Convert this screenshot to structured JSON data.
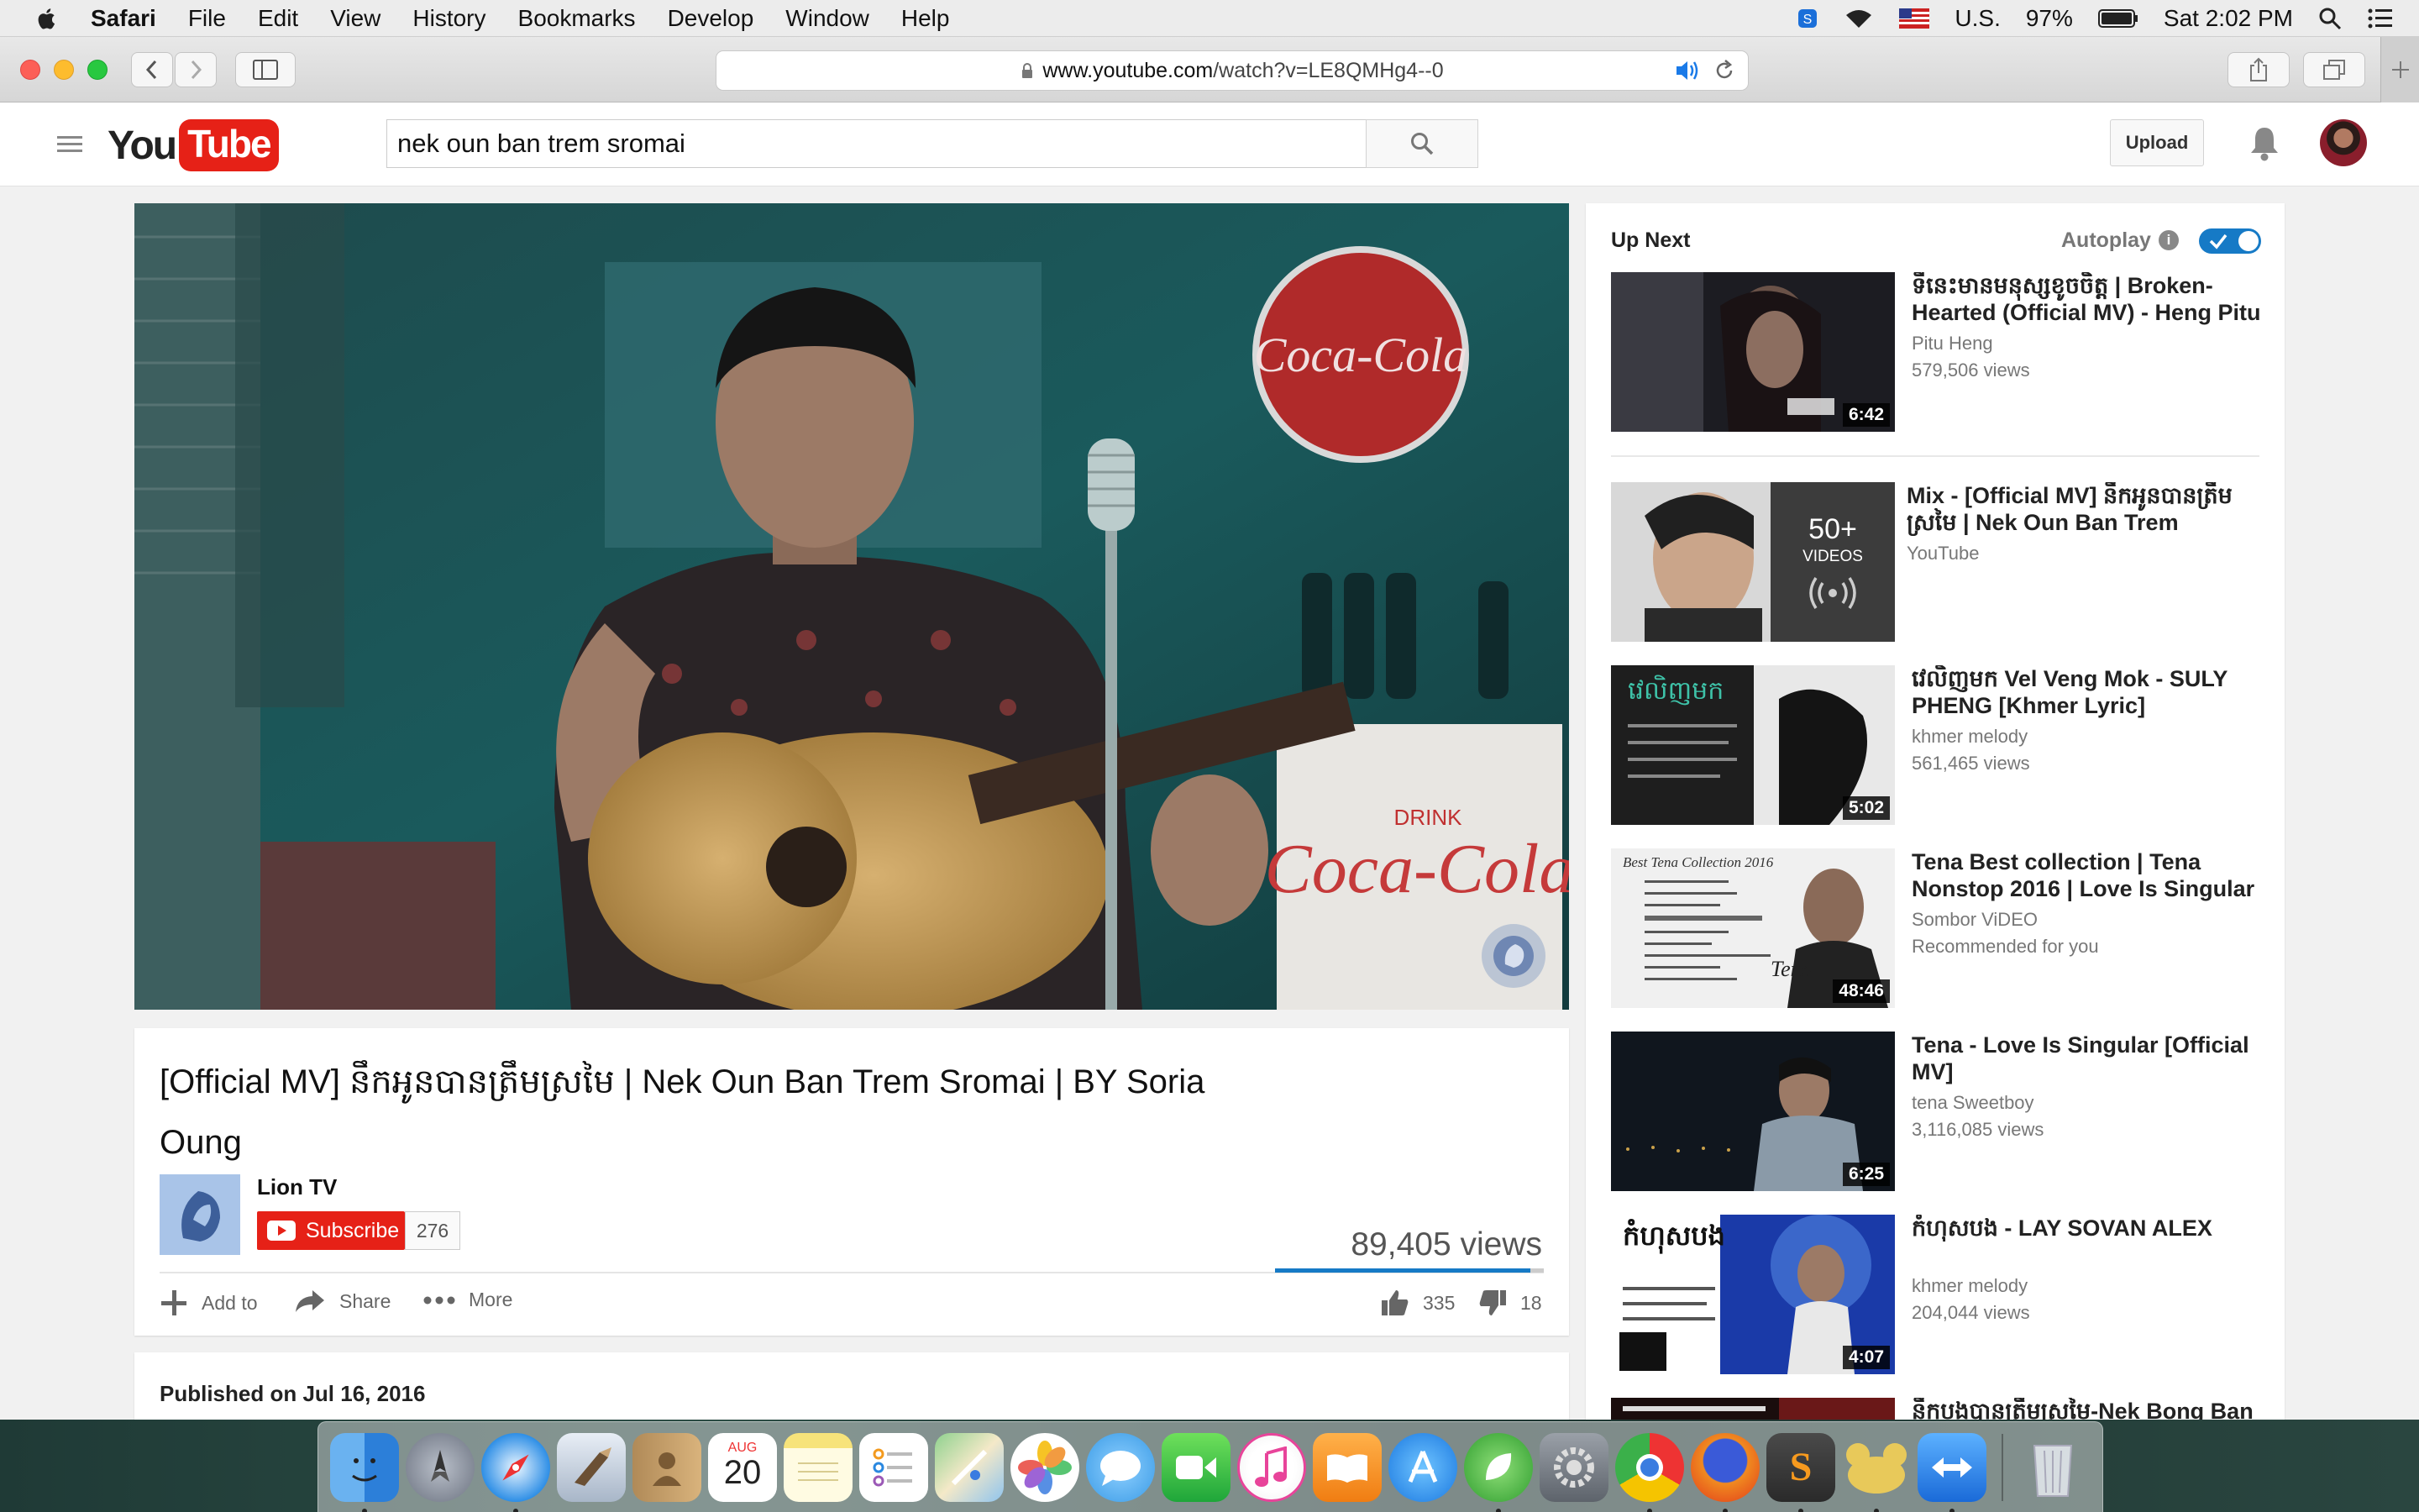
{
  "menubar": {
    "app_name": "Safari",
    "items": [
      "File",
      "Edit",
      "View",
      "History",
      "Bookmarks",
      "Develop",
      "Window",
      "Help"
    ],
    "input_source": "U.S.",
    "battery": "97%",
    "clock": "Sat 2:02 PM"
  },
  "browser": {
    "url_domain": "www.youtube.com",
    "url_path": "/watch?v=LE8QMHg4--0"
  },
  "youtube": {
    "logo_you": "You",
    "logo_tube": "Tube",
    "search_value": "nek oun ban trem sromai",
    "upload_label": "Upload"
  },
  "video": {
    "title": "[Official MV] នឹកអូនបានត្រឹមស្រមៃ | Nek Oun Ban Trem Sromai | BY Soria Oung",
    "channel": "Lion TV",
    "subscribe_label": "Subscribe",
    "subscriber_count": "276",
    "views": "89,405 views",
    "actions": {
      "add_to": "Add to",
      "share": "Share",
      "more": "More"
    },
    "likes": "335",
    "dislikes": "18",
    "like_ratio": 0.95,
    "published": "Published on Jul 16, 2016"
  },
  "sidebar": {
    "up_next_label": "Up Next",
    "autoplay_label": "Autoplay",
    "autoplay_on": true,
    "recommendations": [
      {
        "title": "ទីនេះមានមនុស្សខូចចិត្ត | Broken-Hearted (Official MV) - Heng Pitu",
        "channel": "Pitu Heng",
        "views": "579,506 views",
        "duration": "6:42"
      },
      {
        "title": "Mix - [Official MV] នឹកអូនបានត្រឹមស្រមៃ | Nek Oun Ban Trem",
        "channel": "YouTube",
        "mix_count": "50+",
        "mix_label": "VIDEOS"
      },
      {
        "title": "វេលិញមក Vel Veng Mok - SULY PHENG [Khmer Lyric]",
        "channel": "khmer melody",
        "views": "561,465 views",
        "duration": "5:02"
      },
      {
        "title": "Tena Best collection | Tena Nonstop 2016 | Love Is Singular -",
        "channel": "Sombor ViDEO",
        "views": "Recommended for you",
        "duration": "48:46"
      },
      {
        "title": "Tena - Love Is Singular [Official MV]",
        "channel": "tena Sweetboy",
        "views": "3,116,085 views",
        "duration": "6:25"
      },
      {
        "title": "កំហុសបង - LAY SOVAN ALEX",
        "channel": "khmer melody",
        "views": "204,044 views",
        "duration": "4:07"
      },
      {
        "title": "នឹកបងបានត្រឹមស្រមៃ-Nek Bong Ban",
        "channel": "",
        "views": "",
        "duration": ""
      }
    ]
  },
  "dock": {
    "calendar_month": "AUG",
    "calendar_day": "20",
    "apps": [
      "finder-icon",
      "launchpad-icon",
      "safari-icon",
      "mail-icon",
      "contacts-icon",
      "calendar-icon",
      "notes-icon",
      "reminders-icon",
      "maps-icon",
      "photos-icon",
      "messages-icon",
      "facetime-icon",
      "itunes-icon",
      "ibooks-icon",
      "app-store-icon",
      "sourcetree-icon",
      "system-preferences-icon",
      "chrome-icon",
      "firefox-icon",
      "sublime-text-icon",
      "growl-icon",
      "teamviewer-icon",
      "trash-icon"
    ]
  }
}
